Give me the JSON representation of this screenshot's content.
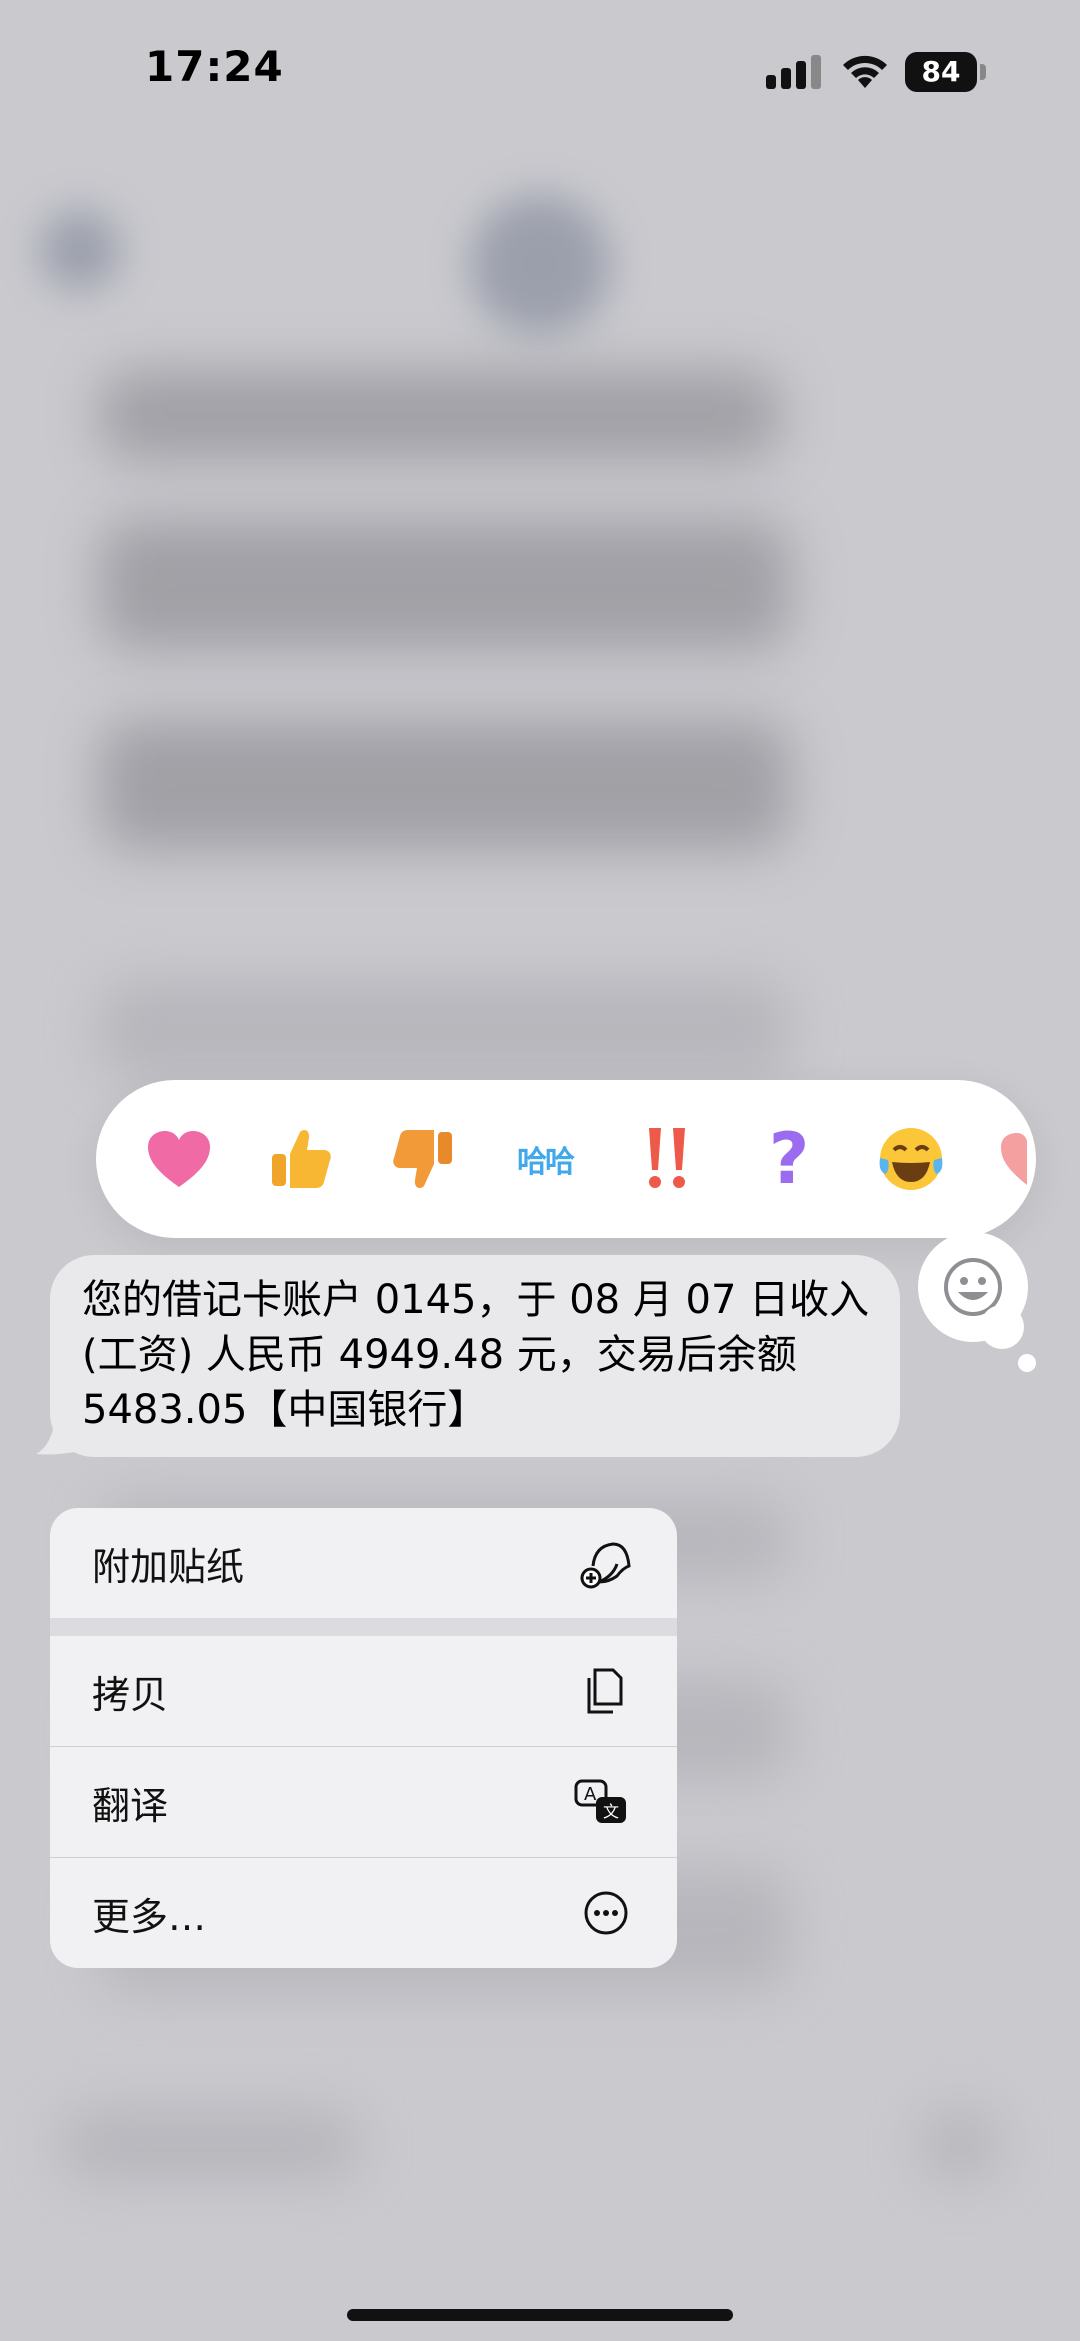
{
  "status_bar": {
    "time": "17:24",
    "battery": "84"
  },
  "reactions": [
    {
      "name": "heart",
      "glyph": "❤"
    },
    {
      "name": "thumbs-up",
      "glyph": "👍"
    },
    {
      "name": "thumbs-down",
      "glyph": "👎"
    },
    {
      "name": "haha",
      "glyph": "哈哈"
    },
    {
      "name": "exclamation",
      "glyph": "‼"
    },
    {
      "name": "question",
      "glyph": "?"
    },
    {
      "name": "laughing",
      "glyph": "😂"
    }
  ],
  "message": {
    "text": "您的借记卡账户 0145，于 08 月 07 日收入 (工资) 人民币 4949.48 元，交易后余额 5483.05【中国银行】"
  },
  "menu": {
    "items": [
      {
        "label": "附加贴纸",
        "icon": "sticker-add-icon"
      },
      {
        "label": "拷贝",
        "icon": "copy-icon"
      },
      {
        "label": "翻译",
        "icon": "translate-icon"
      },
      {
        "label": "更多…",
        "icon": "more-icon"
      }
    ]
  },
  "colors": {
    "bubble": "#e9e9eb",
    "menu": "#f1f1f3",
    "heart": "#f06aa5",
    "question": "#9b6cf0",
    "haha": "#41a8ec",
    "exclamation": "#ee5a4a"
  }
}
